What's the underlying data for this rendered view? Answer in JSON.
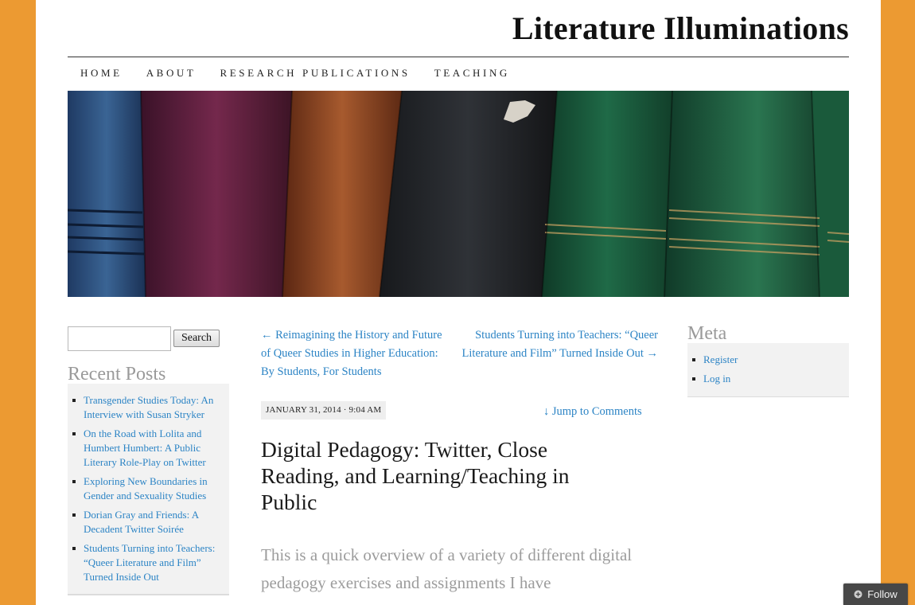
{
  "site": {
    "title": "Literature Illuminations"
  },
  "nav": [
    {
      "label": "Home"
    },
    {
      "label": "About"
    },
    {
      "label": "Research Publications"
    },
    {
      "label": "Teaching"
    }
  ],
  "banner": {
    "icon": "books-header-image"
  },
  "search": {
    "button_label": "Search",
    "value": ""
  },
  "recent_posts": {
    "title": "Recent Posts",
    "items": [
      "Transgender Studies Today: An Interview with Susan Stryker",
      "On the Road with Lolita and Humbert Humbert: A Public Literary Role-Play on Twitter",
      "Exploring New Boundaries in Gender and Sexuality Studies",
      "Dorian Gray and Friends: A Decadent Twitter Soirée",
      "Students Turning into Teachers: “Queer Literature and Film” Turned Inside Out"
    ]
  },
  "post_nav": {
    "prev": "← Reimagining the History and Future of Queer Studies in Higher Education: By Students, For Students",
    "next": "Students Turning into Teachers: “Queer Literature and Film” Turned Inside Out →"
  },
  "post": {
    "date": "JANUARY 31, 2014 · 9:04 AM",
    "jump_link": "↓ Jump to Comments",
    "title": "Digital Pedagogy: Twitter, Close Reading, and Learning/Teaching in Public",
    "excerpt": "This is a quick overview of a variety of different digital pedagogy exercises and assignments I have"
  },
  "meta": {
    "title": "Meta",
    "items": [
      "Register",
      "Log in"
    ]
  },
  "follow": {
    "label": "Follow",
    "icon": "plus-circle-icon"
  },
  "colors": {
    "background": "#ec9a32",
    "link": "#2c84c5",
    "widget_title": "#9a9a9a"
  }
}
